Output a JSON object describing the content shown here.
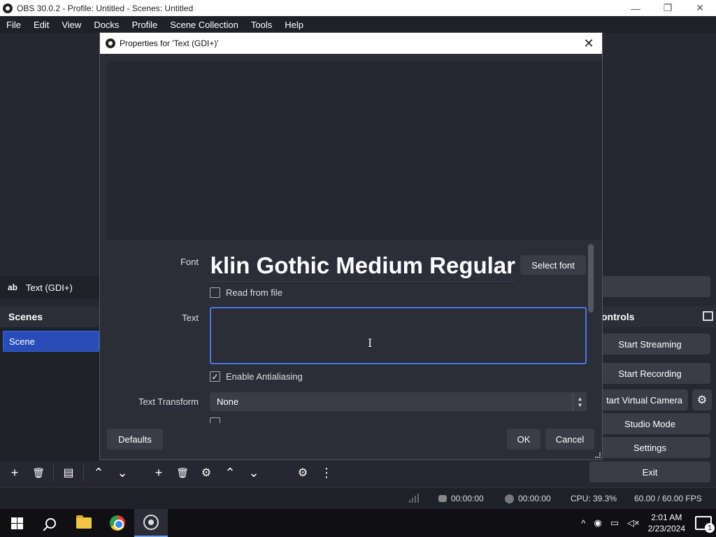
{
  "window": {
    "title": "OBS 30.0.2 - Profile: Untitled - Scenes: Untitled",
    "minimize": "—",
    "maximize": "❐",
    "close": "✕"
  },
  "menu": [
    "File",
    "Edit",
    "View",
    "Docks",
    "Profile",
    "Scene Collection",
    "Tools",
    "Help"
  ],
  "sources": {
    "selected": {
      "icon": "ab",
      "label": "Text (GDI+)"
    }
  },
  "scenes": {
    "header": "Scenes",
    "items": [
      "Scene"
    ]
  },
  "controls": {
    "header": "ontrols",
    "start_streaming": "Start Streaming",
    "start_recording": "Start Recording",
    "virtual_camera": "tart Virtual Camera",
    "studio_mode": "Studio Mode",
    "settings": "Settings",
    "exit": "Exit"
  },
  "dialog": {
    "title": "Properties for 'Text (GDI+)'",
    "close": "✕",
    "font_label": "Font",
    "font_preview": "Franklin Gothic Medium Regular",
    "select_font": "Select font",
    "read_from_file": "Read from file",
    "text_label": "Text",
    "text_value": "",
    "antialiasing": "Enable Antialiasing",
    "antialiasing_checked": "✓",
    "transform_label": "Text Transform",
    "transform_value": "None",
    "defaults": "Defaults",
    "ok": "OK",
    "cancel": "Cancel"
  },
  "status": {
    "stream_time": "00:00:00",
    "record_time": "00:00:00",
    "cpu": "CPU: 39.3%",
    "fps": "60.00 / 60.00 FPS"
  },
  "taskbar": {
    "time": "2:01 AM",
    "date": "2/23/2024",
    "notifications": "1"
  },
  "icons": {
    "add": "+",
    "remove": "🗑",
    "filter": "▤",
    "up": "⌃",
    "down": "⌄",
    "gear": "⚙",
    "more": "⋮",
    "tray_up": "^"
  },
  "colors": {
    "accent": "#284cb8",
    "focus": "#4c75e0",
    "panel": "#2b2e38",
    "button": "#3a3d48"
  }
}
